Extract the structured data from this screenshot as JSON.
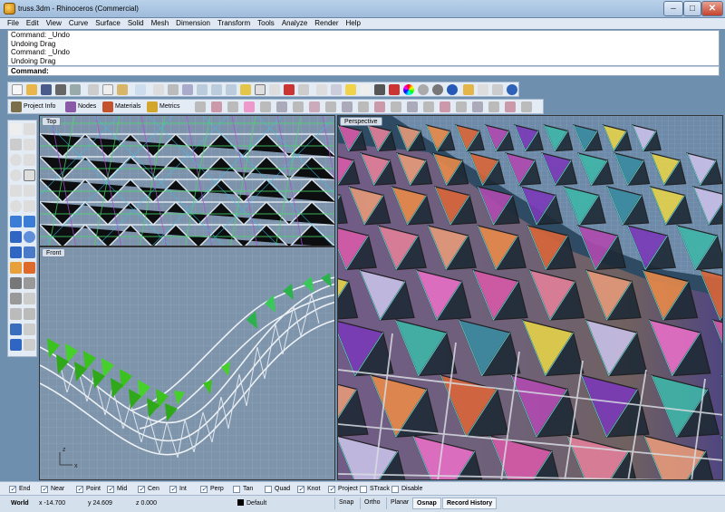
{
  "window": {
    "title": "truss.3dm - Rhinoceros (Commercial)",
    "min": "–",
    "max": "□",
    "close": "✕"
  },
  "menu": [
    "File",
    "Edit",
    "View",
    "Curve",
    "Surface",
    "Solid",
    "Mesh",
    "Dimension",
    "Transform",
    "Tools",
    "Analyze",
    "Render",
    "Help"
  ],
  "command": {
    "history": [
      "Command: _Undo",
      "Undoing Drag",
      "Command: _Undo",
      "Undoing Drag"
    ],
    "prompt": "Command:"
  },
  "toolbar2": {
    "tabs": [
      "Project Info",
      "Nodes",
      "Materials",
      "Metrics"
    ]
  },
  "viewports": {
    "top": "Top",
    "front": "Front",
    "perspective": "Perspective",
    "axis_z": "z",
    "axis_x": "x"
  },
  "osnap": [
    {
      "label": "End",
      "checked": true
    },
    {
      "label": "Near",
      "checked": true
    },
    {
      "label": "Point",
      "checked": true
    },
    {
      "label": "Mid",
      "checked": true
    },
    {
      "label": "Cen",
      "checked": true
    },
    {
      "label": "Int",
      "checked": true
    },
    {
      "label": "Perp",
      "checked": true
    },
    {
      "label": "Tan",
      "checked": false
    },
    {
      "label": "Quad",
      "checked": false
    },
    {
      "label": "Knot",
      "checked": true
    },
    {
      "label": "Project",
      "checked": true
    },
    {
      "label": "STrack",
      "checked": false
    },
    {
      "label": "Disable",
      "checked": false
    }
  ],
  "status": {
    "cplane": "World",
    "x": "x -14.700",
    "y": "y 24.609",
    "z": "z 0.000",
    "layer": "Default",
    "panes": [
      "Snap",
      "Ortho",
      "Planar",
      "Osnap",
      "Record History"
    ]
  },
  "colors": {
    "accent": "#b9d1ea",
    "viewport_bg": "#6f8fae",
    "active_pane": "#f2f6fb"
  }
}
